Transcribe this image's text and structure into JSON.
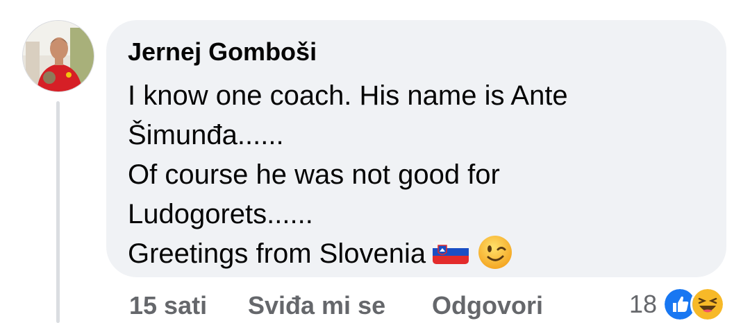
{
  "comment": {
    "author": "Jernej Gomboši",
    "body_lines": [
      "I know one coach. His name is Ante",
      "Šimunđa......",
      "Of course he was not good for",
      "Ludogorets......",
      "Greetings from Slovenia"
    ],
    "emojis": [
      "slovenia-flag",
      "winking-face"
    ],
    "timestamp": "15 sati",
    "like_label": "Sviđa mi se",
    "reply_label": "Odgovori",
    "reaction_count": "18",
    "reactions": [
      "like",
      "haha"
    ]
  },
  "colors": {
    "bubble": "#f0f2f5",
    "text": "#050505",
    "meta": "#65676b",
    "like_blue": "#1877f2",
    "haha_yellow": "#f7b928"
  }
}
